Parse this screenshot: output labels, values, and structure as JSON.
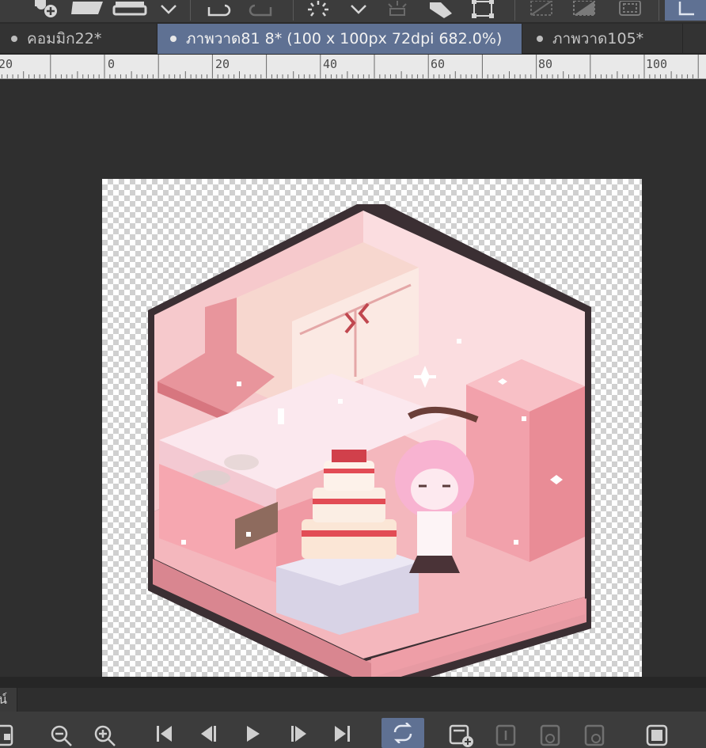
{
  "tabs": [
    {
      "label": "คอมมิก22*"
    },
    {
      "label": "ภาพวาด81 8* (100 x 100px 72dpi 682.0%)"
    },
    {
      "label": "ภาพวาด105*"
    }
  ],
  "active_tab_index": 1,
  "ruler": {
    "labels": [
      "20",
      "0",
      "20",
      "40",
      "60",
      "80",
      "100"
    ]
  },
  "panel": {
    "tab_label": "น์"
  },
  "colors": {
    "accent": "#5f7193",
    "toolbar": "#3c3c3c",
    "canvas_bg": "#2f2f2f"
  },
  "icons": {
    "toolbar": [
      "add-layer-icon",
      "folder-icon",
      "layer-select-icon",
      "chevron-down-icon",
      "undo-icon",
      "redo-icon",
      "loading-icon",
      "chevron-down-icon",
      "sparkle-icon",
      "fill-icon",
      "transform-icon",
      "hide-selection-icon",
      "crop-icon",
      "frame-icon",
      "select-tool-icon"
    ],
    "bottombar": [
      "navigator-icon",
      "zoom-out-icon",
      "zoom-in-icon",
      "first-frame-icon",
      "prev-frame-icon",
      "play-icon",
      "next-frame-icon",
      "last-frame-icon",
      "loop-icon",
      "add-cel-icon",
      "cel-icon",
      "onion-skin-icon",
      "onion-skin-next-icon",
      "frame-settings-icon"
    ]
  }
}
